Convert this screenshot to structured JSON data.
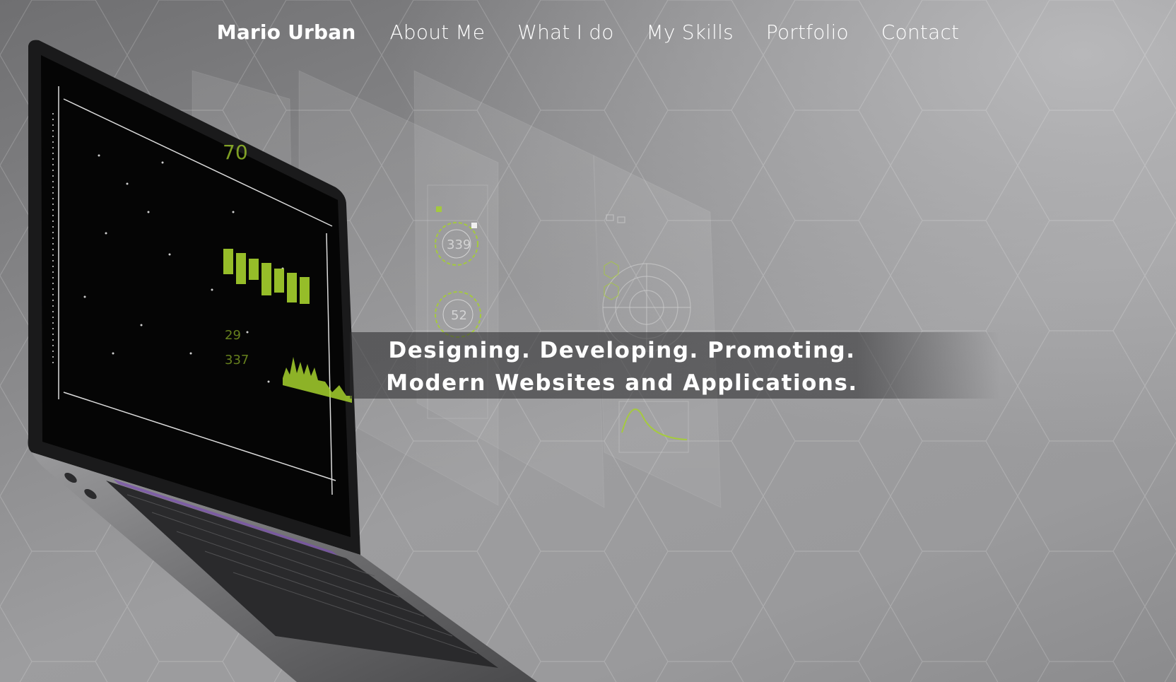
{
  "nav": {
    "brand": "Mario Urban",
    "items": [
      {
        "label": "About Me"
      },
      {
        "label": "What I do"
      },
      {
        "label": "My Skills"
      },
      {
        "label": "Portfolio"
      },
      {
        "label": "Contact"
      }
    ]
  },
  "hero": {
    "tagline_line1": "Designing. Developing. Promoting.",
    "tagline_line2": "Modern Websites and Applications.",
    "screen_readouts": [
      "70",
      "339",
      "52",
      "29",
      "337"
    ],
    "accent_color": "#a6d12e",
    "background_color": "#8c8c8e"
  }
}
